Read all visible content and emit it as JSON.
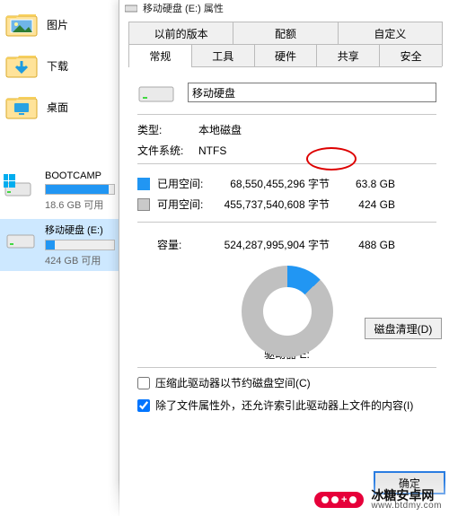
{
  "sidebar": {
    "folders": [
      {
        "label": "图片"
      },
      {
        "label": "下载"
      },
      {
        "label": "桌面"
      }
    ],
    "drives": [
      {
        "name": "BOOTCAMP",
        "free": "18.6 GB 可用",
        "fill_pct": 92,
        "selected": false,
        "has_winlogo": true
      },
      {
        "name": "移动硬盘 (E:)",
        "free": "424 GB 可用",
        "fill_pct": 13,
        "selected": true,
        "has_winlogo": false
      }
    ]
  },
  "dialog": {
    "title": "移动硬盘 (E:) 属性",
    "tabs_row1": [
      "以前的版本",
      "配额",
      "自定义"
    ],
    "tabs_row2": [
      "常规",
      "工具",
      "硬件",
      "共享",
      "安全"
    ],
    "active_tab": "常规",
    "drive_name_value": "移动硬盘",
    "type_label": "类型:",
    "type_value": "本地磁盘",
    "fs_label": "文件系统:",
    "fs_value": "NTFS",
    "used_label": "已用空间:",
    "used_bytes": "68,550,455,296 字节",
    "used_h": "63.8 GB",
    "free_label": "可用空间:",
    "free_bytes": "455,737,540,608 字节",
    "free_h": "424 GB",
    "capacity_label": "容量:",
    "capacity_bytes": "524,287,995,904 字节",
    "capacity_h": "488 GB",
    "drive_letter": "驱动器 E:",
    "cleanup_btn": "磁盘清理(D)",
    "opt1": "压缩此驱动器以节约磁盘空间(C)",
    "opt2": "除了文件属性外，还允许索引此驱动器上文件的内容(I)",
    "opt1_checked": false,
    "opt2_checked": true,
    "ok_btn": "确定"
  },
  "watermark": {
    "cn": "冰糖安卓网",
    "url": "www.btdmy.com"
  }
}
